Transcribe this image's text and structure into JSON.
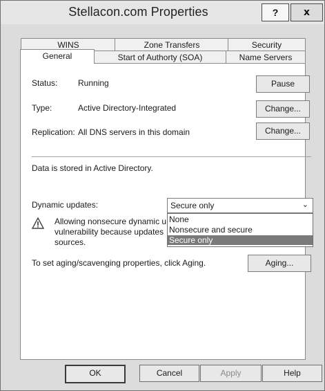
{
  "window": {
    "title": "Stellacon.com Properties"
  },
  "title_buttons": {
    "help": "?",
    "close": "x"
  },
  "tabs_row1": [
    "WINS",
    "Zone Transfers",
    "Security"
  ],
  "tabs_row2": [
    "General",
    "Start of Authorty (SOA)",
    "Name Servers"
  ],
  "active_tab": "General",
  "general": {
    "status_label": "Status:",
    "status_value": "Running",
    "pause_button": "Pause",
    "type_label": "Type:",
    "type_value": "Active Directory-Integrated",
    "type_change_button": "Change...",
    "replication_label": "Replication:",
    "replication_value": "All DNS servers in this domain",
    "replication_change_button": "Change...",
    "storage_text": "Data is stored in Active Directory.",
    "dynamic_updates_label": "Dynamic updates:",
    "dynamic_updates_selected": "Secure only",
    "dynamic_updates_options": [
      "None",
      "Nonsecure and secure",
      "Secure only"
    ],
    "warning_line1": "Allowing nonsecure dynamic u",
    "warning_line2": "vulnerability because updates",
    "warning_line3": "sources.",
    "aging_text": "To set aging/scavenging properties, click Aging.",
    "aging_button": "Aging..."
  },
  "footer": {
    "ok": "OK",
    "cancel": "Cancel",
    "apply": "Apply",
    "help": "Help"
  }
}
